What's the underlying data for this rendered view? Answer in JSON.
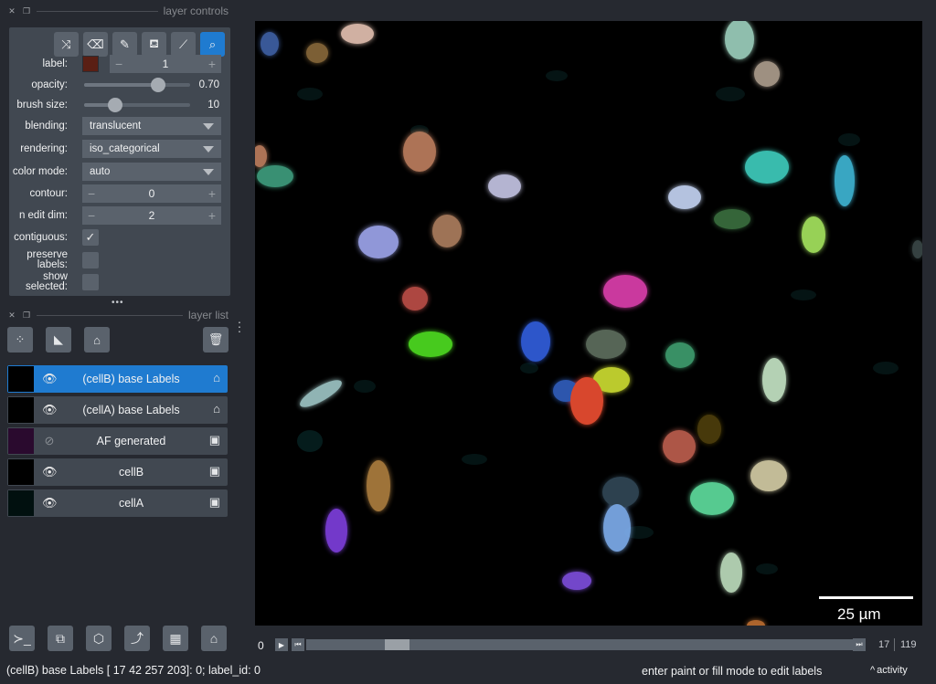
{
  "layer_controls": {
    "title": "layer controls",
    "label": {
      "label": "label:",
      "value": "1",
      "swatch_color": "#5a1f14"
    },
    "opacity": {
      "label": "opacity:",
      "value": "0.70",
      "level": 0.7
    },
    "brush_size": {
      "label": "brush size:",
      "value": "10",
      "level": 0.29
    },
    "blending": {
      "label": "blending:",
      "value": "translucent"
    },
    "rendering": {
      "label": "rendering:",
      "value": "iso_categorical"
    },
    "color_mode": {
      "label": "color mode:",
      "value": "auto"
    },
    "contour": {
      "label": "contour:",
      "value": "0"
    },
    "n_edit_dim": {
      "label": "n edit dim:",
      "value": "2"
    },
    "contiguous": {
      "label": "contiguous:",
      "checked": true
    },
    "preserve_labels": {
      "label": "preserve labels:",
      "checked": false
    },
    "show_selected": {
      "label": "show selected:",
      "checked": false
    },
    "tools": [
      "shuffle-icon",
      "eraser-icon",
      "paintbrush-icon",
      "fill-bucket-icon",
      "color-picker-icon",
      "zoom-icon"
    ],
    "active_tool": "zoom-icon"
  },
  "layer_list": {
    "title": "layer list",
    "layers": [
      {
        "name": "(cellB) base Labels",
        "type": "labels",
        "visible": true,
        "selected": true
      },
      {
        "name": "(cellA) base Labels",
        "type": "labels",
        "visible": true,
        "selected": false
      },
      {
        "name": "AF generated",
        "type": "image",
        "visible": false,
        "selected": false
      },
      {
        "name": "cellB",
        "type": "image",
        "visible": true,
        "selected": false
      },
      {
        "name": "cellA",
        "type": "image",
        "visible": true,
        "selected": false
      }
    ]
  },
  "canvas": {
    "scale_bar_label": "25 µm"
  },
  "dims": {
    "axis": "0",
    "current": "17",
    "total": "119",
    "position": 0.143
  },
  "status": {
    "left": "(cellB) base Labels [ 17  42 257 203]: 0; label_id: 0",
    "right": "enter paint or fill mode to edit labels",
    "activity": "activity"
  }
}
